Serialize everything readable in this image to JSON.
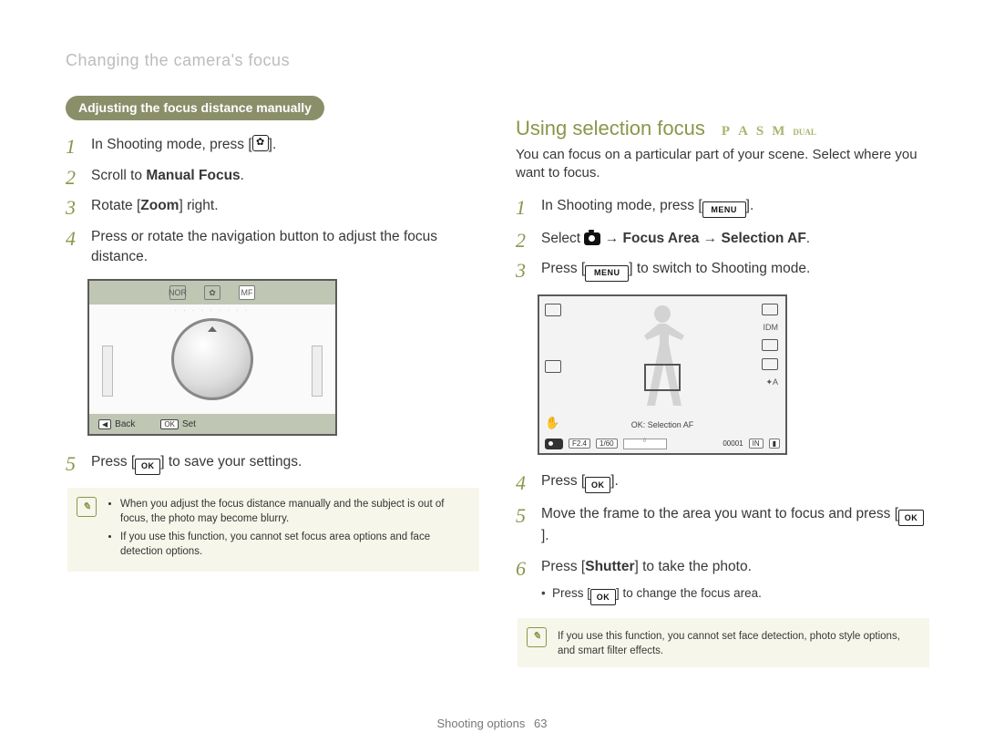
{
  "header": {
    "section": "Changing the camera's focus"
  },
  "left": {
    "pill": "Adjusting the focus distance manually",
    "steps": {
      "s1a": "In Shooting mode, press [",
      "s1b": "].",
      "s2a": "Scroll to ",
      "s2b": "Manual Focus",
      "s2c": ".",
      "s3a": "Rotate [",
      "s3b": "Zoom",
      "s3c": "] right.",
      "s4": "Press or rotate the navigation button to adjust the focus distance.",
      "s5a": "Press [",
      "s5b": "] to save your settings."
    },
    "lcd": {
      "nor": "NOR",
      "back_key": "◀",
      "back": "Back",
      "ok_key": "OK",
      "set": "Set",
      "mf": "MF"
    },
    "notes": [
      "When you adjust the focus distance manually and the subject is out of focus, the photo may become blurry.",
      "If you use this function, you cannot set focus area options and face detection options."
    ]
  },
  "right": {
    "title": "Using selection focus",
    "modes": [
      "P",
      "A",
      "S",
      "M"
    ],
    "mode_dual": "DUAL",
    "intro": "You can focus on a particular part of your scene. Select where you want to focus.",
    "steps": {
      "s1a": "In Shooting mode, press [",
      "s1b": "].",
      "s2a": "Select ",
      "s2arrow": " → ",
      "s2b": "Focus Area",
      "s2c": "Selection AF",
      "s2d": ".",
      "s3a": "Press [",
      "s3b": "] to switch to Shooting mode.",
      "s4a": "Press [",
      "s4b": "].",
      "s5a": "Move the frame to the area you want to focus and press [",
      "s5b": "].",
      "s6a": "Press [",
      "s6b": "Shutter",
      "s6c": "] to take the photo."
    },
    "sub": {
      "a": "Press [",
      "b": "] to change the focus area."
    },
    "lcd": {
      "ok_label": "OK: Selection AF",
      "fnum": "F2.4",
      "shutter": "1/60",
      "count": "00001",
      "ten": "IDM",
      "flash": "✦A",
      "in": "IN"
    },
    "note": "If you use this function, you cannot set face detection, photo style options, and smart filter effects."
  },
  "icons": {
    "menu": "MENU",
    "ok": "OK",
    "note": "✎"
  },
  "footer": {
    "label": "Shooting options",
    "page": "63"
  }
}
